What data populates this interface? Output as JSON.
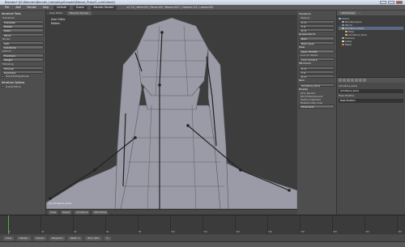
{
  "window": {
    "title": "Blender* [D:\\Blender\\Blender_tutorial\\girl\\model\\Mouse_Proxy3_cut4.blend]"
  },
  "menubar": {
    "items": [
      "File",
      "Add",
      "Render",
      "Help"
    ],
    "layout": "Default",
    "scene": "Scene",
    "engine": "Blender Render",
    "stats": "v2.74 | Verts:0/0 | Faces:0/0 | Bones:0/27 | Objects:1/4 | Lamps:0/0"
  },
  "tool_shelf": {
    "header": "Armature Tools",
    "sections": [
      {
        "title": "Transform",
        "buttons": [
          "Translate",
          "Rotate",
          "Scale",
          "Mirror"
        ]
      },
      {
        "title": "Bones",
        "buttons": [
          "Add",
          "Subdivide"
        ]
      },
      {
        "title": "Deform",
        "buttons": [
          "Envelope",
          "Weight"
        ]
      },
      {
        "title": "Modeling",
        "buttons": [
          "Extrude",
          "Duplicate"
        ]
      }
    ],
    "toggle": "Use Existing Bones",
    "options_header": "Armature Options",
    "x_mirror_label": "X-Axis Mirror"
  },
  "viewport": {
    "header": "User Ortho",
    "info_line1": "User Ortho",
    "info_line2": "Meters",
    "footer_items": [
      "View",
      "Select",
      "Armature",
      "Edit Mode"
    ],
    "footer_mode": "Edit Mode",
    "object_label": "(1) Armature_bone"
  },
  "props": {
    "sections": [
      {
        "title": "Transform",
        "rows": [
          "Median:",
          "X: 0",
          "Y: 0",
          "Z: 0"
        ]
      },
      {
        "title": "Grease Pencil",
        "rows": [
          "Draw",
          "Line",
          "Erase"
        ]
      },
      {
        "title": "View",
        "rows": [
          "Lens: 35.000",
          "Lock to Object",
          "Lock to Cursor"
        ]
      },
      {
        "title": "3D Cursor",
        "rows": [
          "X: 0",
          "Y: 0",
          "Z: 0"
        ]
      },
      {
        "title": "Item",
        "rows": [
          "Armature_bone"
        ]
      },
      {
        "title": "Display",
        "rows": [
          "Only Render",
          "World Background",
          "Outline Selected",
          "Relationship Lines"
        ]
      }
    ],
    "buttons": [
      "New",
      "New Layer",
      "Lock Camera",
      "Show Grid"
    ]
  },
  "outliner": {
    "view": "All Scenes",
    "search": "",
    "nodes": [
      {
        "name": "Scene",
        "selected": false
      },
      {
        "name": "RenderLayers",
        "selected": false
      },
      {
        "name": "World",
        "selected": false
      },
      {
        "name": "Armature_bone",
        "selected": true
      },
      {
        "name": "Pose",
        "selected": false
      },
      {
        "name": "Armature_bone",
        "selected": false
      },
      {
        "name": "Camera",
        "selected": false
      },
      {
        "name": "Lamp",
        "selected": false
      },
      {
        "name": "Mesh",
        "selected": false
      }
    ],
    "colors": {
      "armature": "#e8c062",
      "mesh": "#eb8f3a",
      "camera": "#9dc0e8",
      "lamp": "#f2f2a6"
    }
  },
  "properties_editor": {
    "object_name": "Armature_bone",
    "pose_label": "Pose Position",
    "mode": "Rest Position",
    "field": "Armature_bone"
  },
  "timeline": {
    "labels": [
      "0",
      "20",
      "40",
      "60",
      "80",
      "100",
      "120",
      "140",
      "160",
      "180",
      "200",
      "220",
      "240"
    ],
    "footer_items": [
      "View",
      "Marker",
      "Frame",
      "Playback"
    ],
    "start": "Start: 1",
    "end": "End: 250",
    "current": "1",
    "cursor_color": "#4db04d"
  },
  "colors": {
    "viewport_bg": "#3d3d3d",
    "mesh_face": "#9a9ba6",
    "bone": "#222222"
  }
}
